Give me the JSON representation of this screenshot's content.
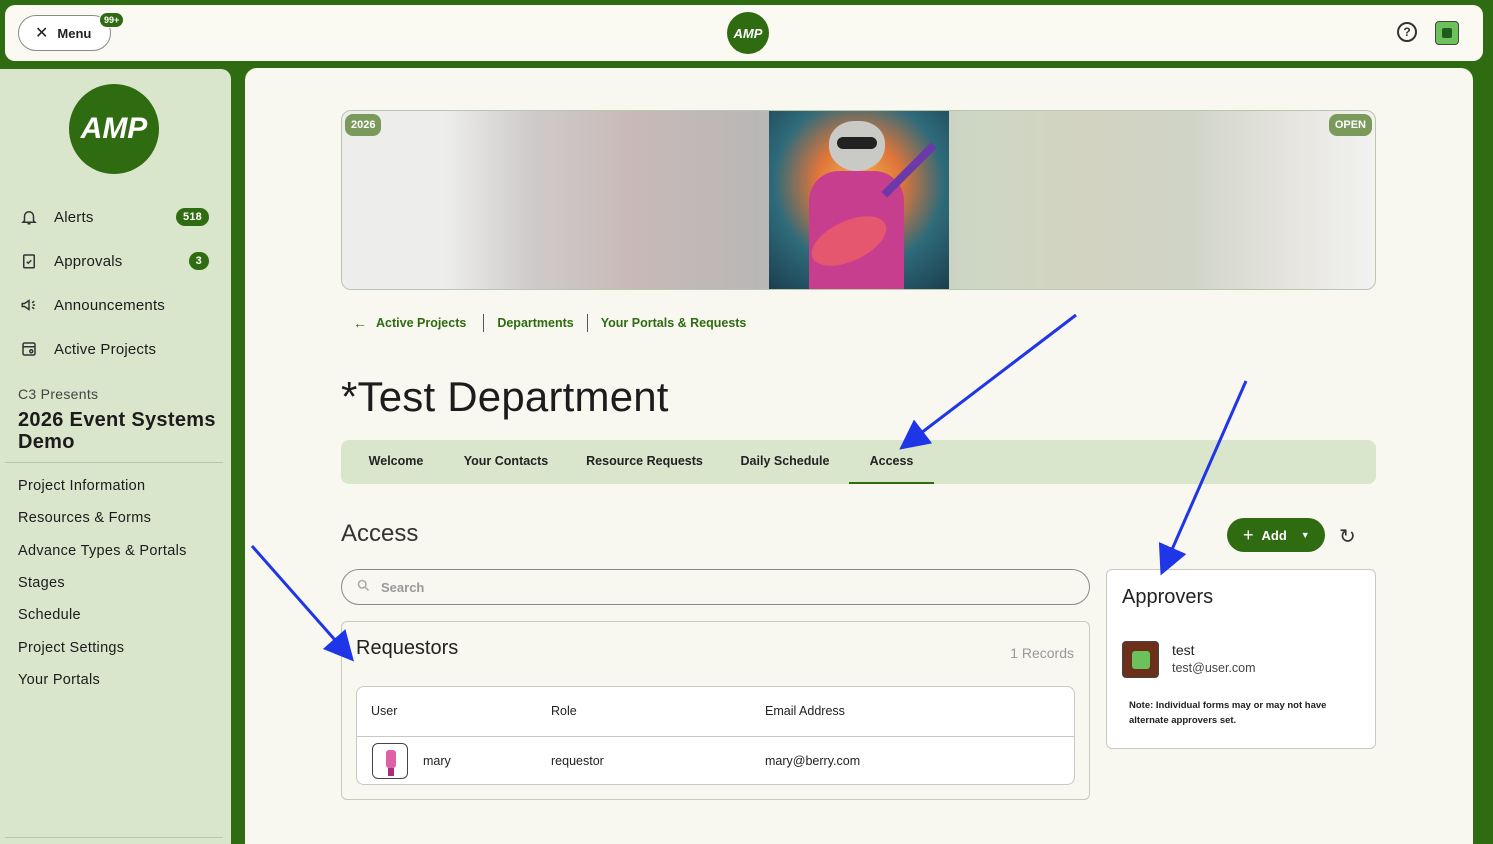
{
  "topbar": {
    "menu_label": "Menu",
    "menu_badge": "99+",
    "logo_text": "AMP"
  },
  "sidebar": {
    "logo_text": "AMP",
    "nav": [
      {
        "label": "Alerts",
        "badge": "518",
        "icon": "bell-icon"
      },
      {
        "label": "Approvals",
        "badge": "3",
        "icon": "clipboard-check-icon"
      },
      {
        "label": "Announcements",
        "badge": "",
        "icon": "megaphone-icon"
      },
      {
        "label": "Active Projects",
        "badge": "",
        "icon": "projects-icon"
      }
    ],
    "project_subtitle": "C3 Presents",
    "project_title": "2026 Event Systems Demo",
    "links": [
      "Project Information",
      "Resources & Forms",
      "Advance Types & Portals",
      "Stages",
      "Schedule",
      "Project Settings",
      "Your Portals"
    ]
  },
  "banner": {
    "year_chip": "2026",
    "status_chip": "OPEN"
  },
  "breadcrumb": [
    "Active Projects",
    "Departments",
    "Your Portals & Requests"
  ],
  "page_title": "*Test Department",
  "tabs": [
    {
      "label": "Welcome",
      "active": false
    },
    {
      "label": "Your Contacts",
      "active": false
    },
    {
      "label": "Resource Requests",
      "active": false
    },
    {
      "label": "Daily Schedule",
      "active": false
    },
    {
      "label": "Access",
      "active": true
    }
  ],
  "access": {
    "title": "Access",
    "add_label": "Add",
    "search_placeholder": "Search",
    "requestors": {
      "title": "Requestors",
      "count": "1 Records",
      "columns": [
        "User",
        "Role",
        "Email Address"
      ],
      "rows": [
        {
          "user": "mary",
          "role": "requestor",
          "email": "mary@berry.com"
        }
      ]
    },
    "approvers": {
      "title": "Approvers",
      "name": "test",
      "email": "test@user.com",
      "note": "Note: Individual forms may or may not have alternate approvers set."
    }
  },
  "colors": {
    "brand_green": "#2f6b10",
    "light_green": "#d9e6cc",
    "annotation_arrow": "#1e35e8"
  }
}
